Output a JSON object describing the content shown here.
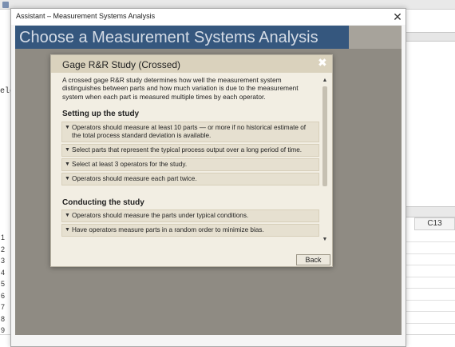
{
  "background": {
    "left_pane_text": "elc",
    "column_header": "C13",
    "row_numbers": [
      "1",
      "2",
      "3",
      "4",
      "5",
      "6",
      "7",
      "8",
      "9"
    ]
  },
  "window": {
    "title": "Assistant – Measurement Systems Analysis",
    "close_glyph": "✕"
  },
  "banner": {
    "title": "Choose a Measurement Systems Analysis"
  },
  "dialog": {
    "title": "Gage R&R Study (Crossed)",
    "close_glyph": "✖",
    "intro": "A crossed gage R&R study determines how well the measurement system distinguishes between parts and how much variation is due to the measurement system when each part is measured multiple times by each operator.",
    "sections": [
      {
        "heading": "Setting up the study",
        "items": [
          "Operators should measure at least 10 parts — or more if no historical estimate of the total process standard deviation is available.",
          "Select parts that represent the typical process output over a long period of time.",
          "Select at least 3 operators for the study.",
          "Operators should measure each part twice."
        ]
      },
      {
        "heading": "Conducting the study",
        "items": [
          "Operators should measure the parts under typical conditions.",
          "Have operators measure parts in a random order to minimize bias."
        ]
      }
    ],
    "back_label": "Back",
    "chevron_icon": "chevron-down-icon",
    "scroll_up_icon": "chevron-up-icon"
  },
  "colors": {
    "banner": "#35577e",
    "dialog_bg": "#f2eee3",
    "dialog_header": "#dad2bd",
    "item_bg": "#e6e0d0",
    "overlay": "#8f8b83"
  }
}
